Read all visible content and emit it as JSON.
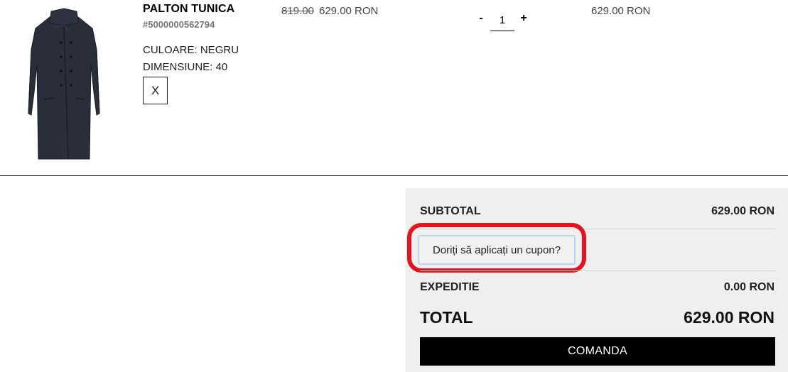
{
  "cart_item": {
    "name": "PALTON TUNICA",
    "sku": "#5000000562794",
    "color": "CULOARE: NEGRU",
    "size": "DIMENSIUNE: 40",
    "remove_label": "X",
    "price_old": "819.00",
    "price_new": "629.00 RON",
    "qty_minus": "-",
    "qty_value": "1",
    "qty_plus": "+",
    "line_total": "629.00 RON",
    "image_icon": "coat-product-image"
  },
  "summary": {
    "subtotal_label": "SUBTOTAL",
    "subtotal_value": "629.00 RON",
    "coupon_label": "Doriți să aplicați un cupon?",
    "shipping_label": "EXPEDITIE",
    "shipping_value": "0.00 RON",
    "total_label": "TOTAL",
    "total_value": "629.00 RON",
    "order_label": "COMANDA",
    "panel_color": "#efefef",
    "highlight_color": "#e3141f"
  }
}
